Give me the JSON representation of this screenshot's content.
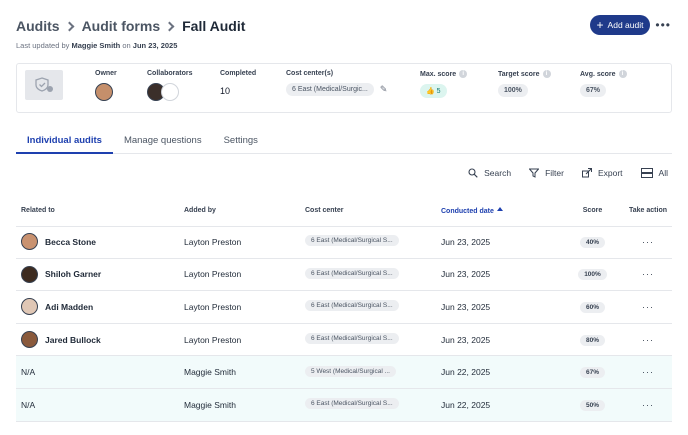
{
  "breadcrumb": {
    "root": "Audits",
    "parent": "Audit forms",
    "current": "Fall Audit"
  },
  "subtitle": {
    "prefix": "Last updated by",
    "user": "Maggie Smith",
    "on": "on",
    "date": "Jun 23, 2025"
  },
  "header_actions": {
    "add_label": "Add audit",
    "more_icon": "more-horizontal-icon"
  },
  "summary": {
    "owner_label": "Owner",
    "collaborators_label": "Collaborators",
    "completed_label": "Completed",
    "completed_value": "10",
    "cost_center_label": "Cost center(s)",
    "cost_center_value": "6 East (Medical/Surgic...",
    "max_score_label": "Max. score",
    "max_score_value": "5",
    "target_score_label": "Target score",
    "target_score_value": "100%",
    "avg_score_label": "Avg. score",
    "avg_score_value": "67%"
  },
  "tabs": [
    {
      "label": "Individual audits",
      "active": true
    },
    {
      "label": "Manage questions",
      "active": false
    },
    {
      "label": "Settings",
      "active": false
    }
  ],
  "toolbar": {
    "search": "Search",
    "filter": "Filter",
    "export": "Export",
    "view": "All"
  },
  "table": {
    "headers": {
      "related_to": "Related to",
      "added_by": "Added by",
      "cost_center": "Cost center",
      "conducted_date": "Conducted date",
      "score": "Score",
      "take_action": "Take action"
    },
    "rows": [
      {
        "related_to": "Becca Stone",
        "added_by": "Layton Preston",
        "cost_center": "6 East (Medical/Surgical S...",
        "date": "Jun 23, 2025",
        "score": "40%"
      },
      {
        "related_to": "Shiloh Garner",
        "added_by": "Layton Preston",
        "cost_center": "6 East (Medical/Surgical S...",
        "date": "Jun 23, 2025",
        "score": "100%"
      },
      {
        "related_to": "Adi Madden",
        "added_by": "Layton Preston",
        "cost_center": "6 East (Medical/Surgical S...",
        "date": "Jun 23, 2025",
        "score": "60%"
      },
      {
        "related_to": "Jared Bullock",
        "added_by": "Layton Preston",
        "cost_center": "6 East (Medical/Surgical S...",
        "date": "Jun 23, 2025",
        "score": "80%"
      },
      {
        "related_to": "N/A",
        "added_by": "Maggie Smith",
        "cost_center": "5 West (Medical/Surgical ...",
        "date": "Jun 22, 2025",
        "score": "67%"
      },
      {
        "related_to": "N/A",
        "added_by": "Maggie Smith",
        "cost_center": "6 East (Medical/Surgical S...",
        "date": "Jun 22, 2025",
        "score": "50%"
      }
    ]
  },
  "colors": {
    "primary": "#1f3a8a",
    "tab_active": "#1e40af",
    "row_highlight": "#f2fbfb"
  }
}
